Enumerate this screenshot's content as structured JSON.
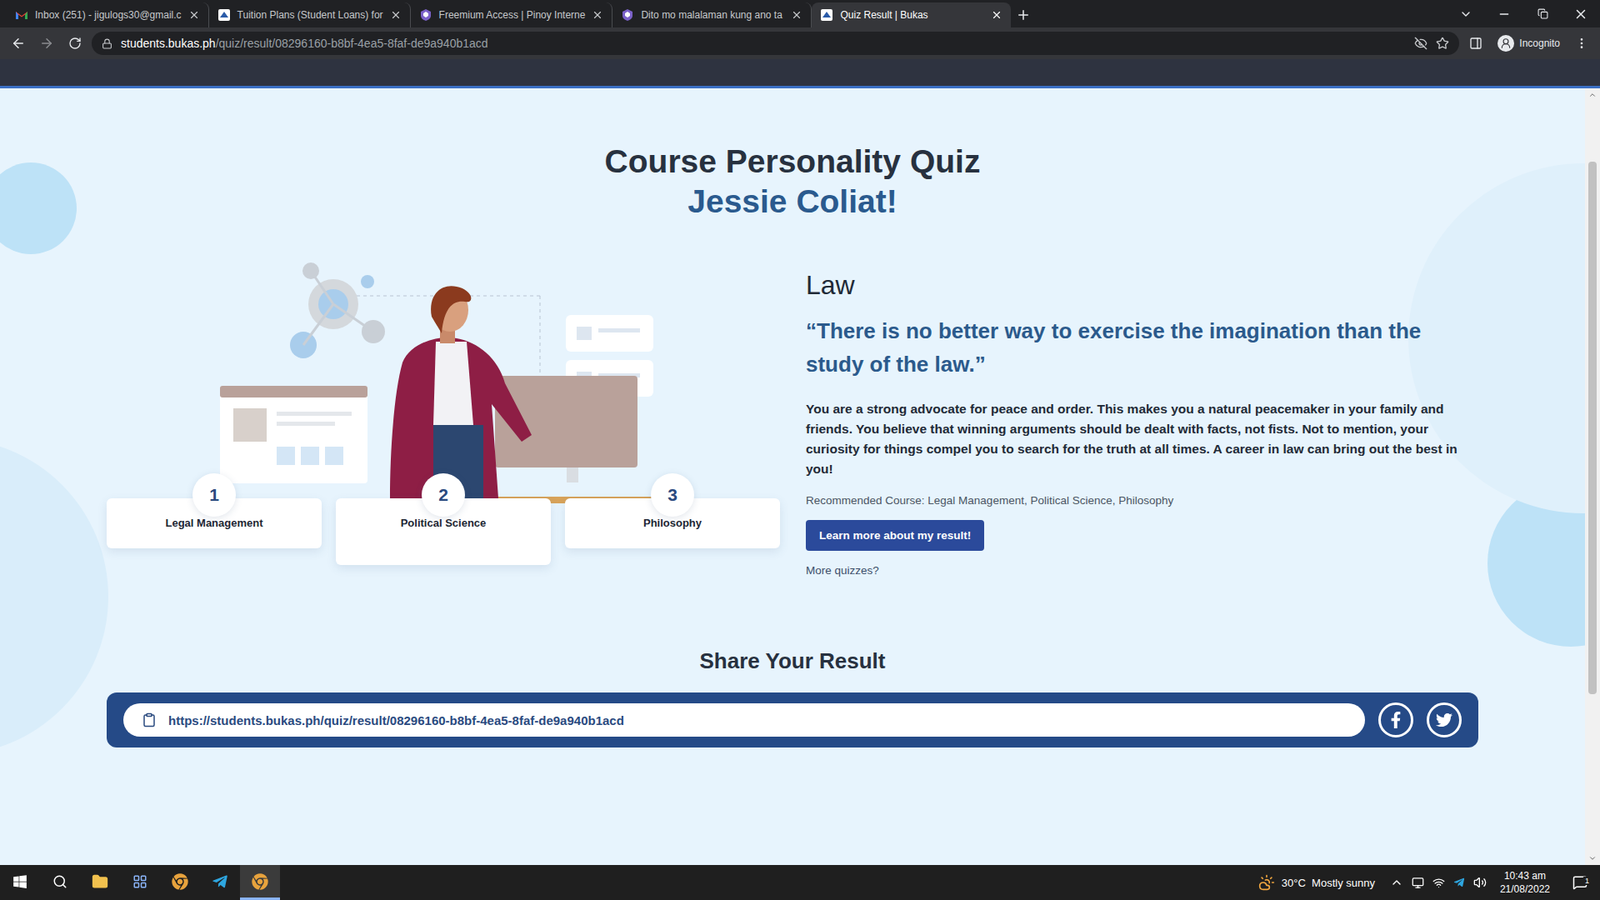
{
  "browser": {
    "tabs": [
      {
        "label": "Inbox (251) - jigulogs30@gmail.c",
        "icon": "gmail",
        "selected": false
      },
      {
        "label": "Tuition Plans (Student Loans) for",
        "icon": "bukas",
        "selected": false
      },
      {
        "label": "Freemium Access | Pinoy Interne",
        "icon": "pinoy",
        "selected": false
      },
      {
        "label": "Dito mo malalaman kung ano ta",
        "icon": "pinoy",
        "selected": false
      },
      {
        "label": "Quiz Result | Bukas",
        "icon": "bukas",
        "selected": true
      }
    ],
    "address": {
      "domain": "students.bukas.ph",
      "path": "/quiz/result/08296160-b8bf-4ea5-8faf-de9a940b1acd"
    },
    "profile": "Incognito"
  },
  "page": {
    "title": "Course Personality Quiz",
    "name": "Jessie Coliat!",
    "result": {
      "heading": "Law",
      "quote": "“There is no better way to exercise the imagination than the study of the law.”",
      "description": "You are a strong advocate for peace and order. This makes you a natural peacemaker in your family and friends. You believe that winning arguments should be dealt with facts, not fists. Not to mention, your curiosity for things compel you to search for the truth at all times. A career in law can bring out the best in you!",
      "recommended": "Recommended Course: Legal Management, Political Science, Philosophy",
      "button": "Learn more about my result!",
      "link": "More quizzes?"
    },
    "courses": [
      {
        "number": "1",
        "name": "Legal Management"
      },
      {
        "number": "2",
        "name": "Political Science"
      },
      {
        "number": "3",
        "name": "Philosophy"
      }
    ],
    "share": {
      "title": "Share Your Result",
      "url": "https://students.bukas.ph/quiz/result/08296160-b8bf-4ea5-8faf-de9a940b1acd"
    },
    "scroll": {
      "offset": 0.08,
      "level": 0.71
    }
  },
  "taskbar": {
    "weather": "30°C  Mostly sunny",
    "time": "10:43 am",
    "date": "21/08/2022",
    "notifications": "1"
  }
}
